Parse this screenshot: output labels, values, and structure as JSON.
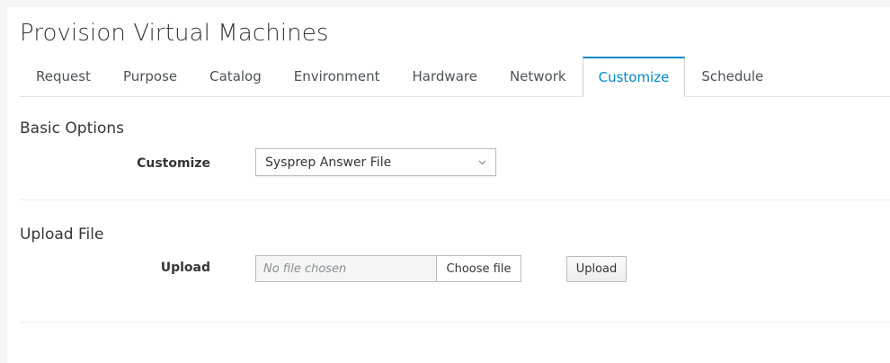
{
  "page": {
    "title": "Provision Virtual Machines"
  },
  "tabs": [
    {
      "label": "Request",
      "active": false
    },
    {
      "label": "Purpose",
      "active": false
    },
    {
      "label": "Catalog",
      "active": false
    },
    {
      "label": "Environment",
      "active": false
    },
    {
      "label": "Hardware",
      "active": false
    },
    {
      "label": "Network",
      "active": false
    },
    {
      "label": "Customize",
      "active": true
    },
    {
      "label": "Schedule",
      "active": false
    }
  ],
  "basic_options": {
    "title": "Basic Options",
    "customize_label": "Customize",
    "customize_value": "Sysprep Answer File"
  },
  "upload_file": {
    "title": "Upload File",
    "upload_label": "Upload",
    "file_placeholder": "No file chosen",
    "choose_label": "Choose file",
    "upload_button": "Upload"
  },
  "colors": {
    "accent": "#0088ce",
    "text": "#363636",
    "background": "#f5f5f5"
  },
  "icons": {
    "select_caret": "chevron-down-icon"
  }
}
